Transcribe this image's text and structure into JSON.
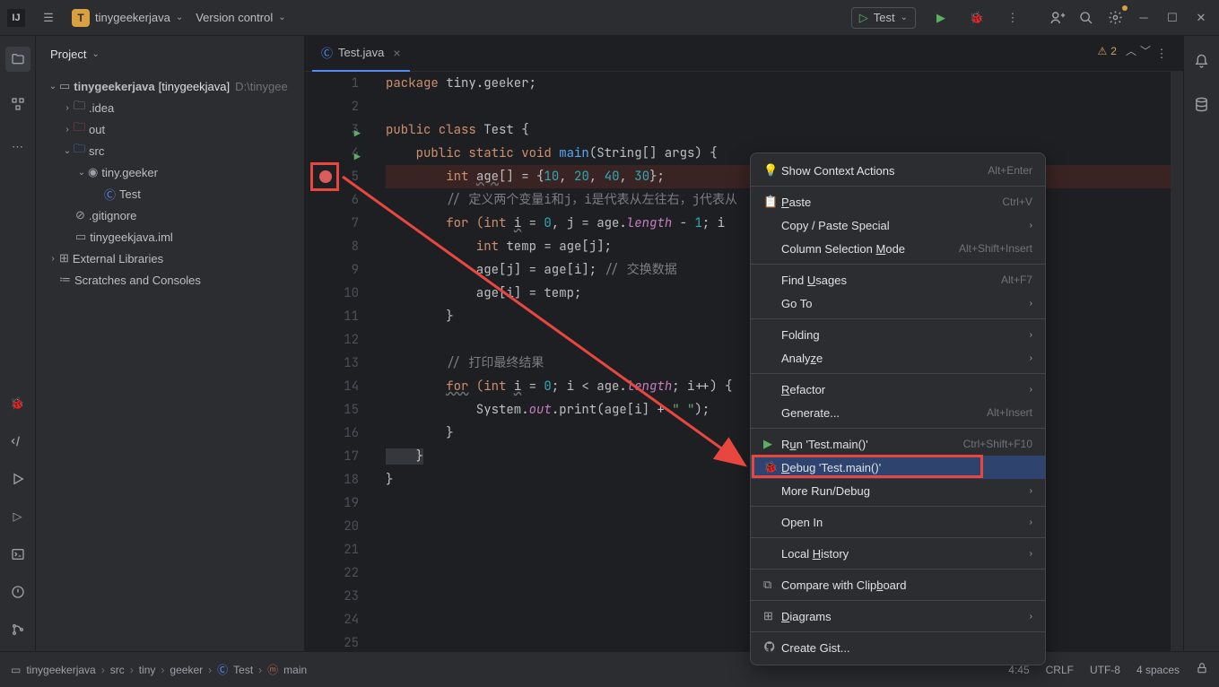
{
  "topbar": {
    "project_name": "tinygeekerjava",
    "version_control": "Version control",
    "run_config": "Test"
  },
  "project": {
    "title": "Project",
    "root": "tinygeekerjava",
    "module": "[tinygeekjava]",
    "path": "D:\\tinygee",
    "idea": ".idea",
    "out": "out",
    "src": "src",
    "package": "tiny.geeker",
    "test_class": "Test",
    "gitignore": ".gitignore",
    "iml": "tinygeekjava.iml",
    "external": "External Libraries",
    "scratches": "Scratches and Consoles"
  },
  "tabs": {
    "active": "Test.java"
  },
  "warnings": {
    "count": "2"
  },
  "code": {
    "l1_pkg": "package",
    "l1_rest": " tiny.geeker;",
    "l3_a": "public class ",
    "l3_b": "Test ",
    "l3_c": "{",
    "l4_a": "    public static void ",
    "l4_b": "main",
    "l4_c": "(String[] args) {",
    "l5_a": "        int ",
    "l5_b": "age",
    "l5_c": "[] = {",
    "l5_n1": "10",
    "l5_s": ", ",
    "l5_n2": "20",
    "l5_n3": "40",
    "l5_n4": "30",
    "l5_e": "};",
    "l6": "        // 定义两个变量i和j，i是代表从左往右，j代表从",
    "l7_a": "        for ",
    "l7_b": "(int ",
    "l7_c": "i",
    "l7_d": " = ",
    "l7_e": "0",
    "l7_f": ", j = age.",
    "l7_g": "length",
    "l7_h": " - ",
    "l7_i": "1",
    "l7_j": "; i ",
    "l8_a": "            int ",
    "l8_b": "temp = age[j];",
    "l9_a": "            age[j] = age[i]; ",
    "l9_b": "// 交换数据",
    "l10": "            age[i] = temp;",
    "l11": "        }",
    "l13": "        // 打印最终结果",
    "l14_a": "        ",
    "l14_for": "for",
    "l14_b": " (int ",
    "l14_c": "i",
    "l14_d": " = ",
    "l14_e": "0",
    "l14_f": "; i < age.",
    "l14_g": "length",
    "l14_h": "; i++) {",
    "l15_a": "            System.",
    "l15_b": "out",
    "l15_c": ".print(age[i] + ",
    "l15_d": "\" \"",
    "l15_e": ");",
    "l16": "        }",
    "l17": "    }",
    "l18": "}"
  },
  "menu": {
    "show_actions": "Show Context Actions",
    "show_actions_sc": "Alt+Enter",
    "paste": "Paste",
    "paste_sc": "Ctrl+V",
    "copy_paste": "Copy / Paste Special",
    "column": "Column Selection Mode",
    "column_sc": "Alt+Shift+Insert",
    "find_usages": "Find Usages",
    "find_usages_sc": "Alt+F7",
    "goto": "Go To",
    "folding": "Folding",
    "analyze": "Analyze",
    "refactor": "Refactor",
    "generate": "Generate...",
    "generate_sc": "Alt+Insert",
    "run": "Run 'Test.main()'",
    "run_sc": "Ctrl+Shift+F10",
    "debug": "Debug 'Test.main()'",
    "more_run": "More Run/Debug",
    "open_in": "Open In",
    "local_hist": "Local History",
    "compare": "Compare with Clipboard",
    "diagrams": "Diagrams",
    "gist": "Create Gist..."
  },
  "breadcrumb": {
    "root": "tinygeekerjava",
    "src": "src",
    "p1": "tiny",
    "p2": "geeker",
    "cls": "Test",
    "m": "main"
  },
  "status": {
    "pos": "4:45",
    "crlf": "CRLF",
    "enc": "UTF-8",
    "indent": "4 spaces"
  }
}
